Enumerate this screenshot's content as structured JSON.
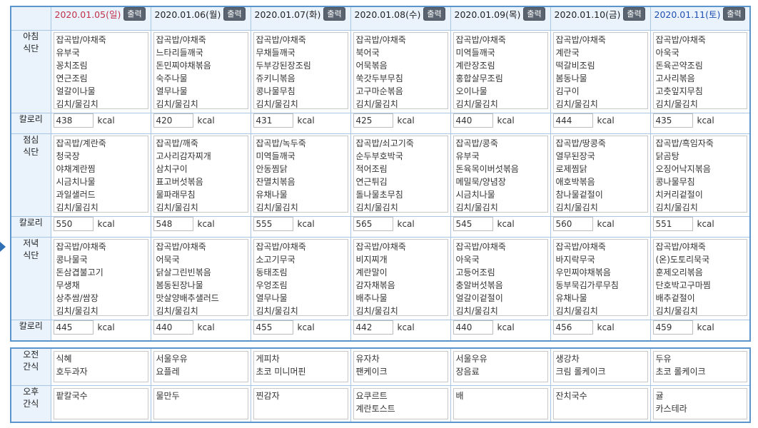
{
  "print_label": "출력",
  "kcal_unit": "kcal",
  "labels": {
    "breakfast": [
      "아침",
      "식단"
    ],
    "lunch": [
      "점심",
      "식단"
    ],
    "dinner": [
      "저녁",
      "식단"
    ],
    "calorie": "칼로리",
    "am_snack": [
      "오전",
      "간식"
    ],
    "pm_snack": [
      "오후",
      "간식"
    ]
  },
  "days": [
    {
      "date": "2020.01.05",
      "weekday": "(일)",
      "breakfast": [
        "잡곡밥/야채죽",
        "유부국",
        "꽁치조림",
        "연근조림",
        "얼갈이나물",
        "김치/물김치"
      ],
      "breakfast_kcal": "438",
      "lunch": [
        "잡곡밥/계란죽",
        "청국장",
        "야채계란찜",
        "시금치나물",
        "과일샐러드",
        "김치/물김치"
      ],
      "lunch_kcal": "550",
      "dinner": [
        "잡곡밥/야채죽",
        "콩나물국",
        "돈삼겹불고기",
        "무생채",
        "상추쌈/쌈장",
        "김치/물김치"
      ],
      "dinner_kcal": "445",
      "am_snack": [
        "식혜",
        "호두과자"
      ],
      "pm_snack": [
        "팥칼국수"
      ]
    },
    {
      "date": "2020.01.06",
      "weekday": "(월)",
      "breakfast": [
        "잡곡밥/야채죽",
        "느타리들깨국",
        "돈민찌야채볶음",
        "숙주나물",
        "열무나물",
        "김치/물김치"
      ],
      "breakfast_kcal": "420",
      "lunch": [
        "잡곡밥/깨죽",
        "고사리감자찌개",
        "삼치구이",
        "표고버섯볶음",
        "물파래무침",
        "김치/물김치"
      ],
      "lunch_kcal": "548",
      "dinner": [
        "잡곡밥/야채죽",
        "어묵국",
        "닭살그린빈볶음",
        "봄동된장나물",
        "맛살양배추샐러드",
        "김치/물김치"
      ],
      "dinner_kcal": "440",
      "am_snack": [
        "서울우유",
        "요플레"
      ],
      "pm_snack": [
        "물만두"
      ]
    },
    {
      "date": "2020.01.07",
      "weekday": "(화)",
      "breakfast": [
        "잡곡밥/야채죽",
        "무채들깨국",
        "두부강된장조림",
        "쥬키니볶음",
        "콩나물무침",
        "김치/물김치"
      ],
      "breakfast_kcal": "431",
      "lunch": [
        "잡곡밥/녹두죽",
        "미역들깨국",
        "안동찜닭",
        "잔멸치볶음",
        "유채나물",
        "김치/물김치"
      ],
      "lunch_kcal": "555",
      "dinner": [
        "잡곡밥/야채죽",
        "소고기무국",
        "동태조림",
        "우엉조림",
        "열무나물",
        "김치/물김치"
      ],
      "dinner_kcal": "455",
      "am_snack": [
        "게피차",
        "초코 미니머핀"
      ],
      "pm_snack": [
        "찐감자"
      ]
    },
    {
      "date": "2020.01.08",
      "weekday": "(수)",
      "breakfast": [
        "잡곡밥/야채죽",
        "북어국",
        "어묵볶음",
        "쑥갓두부무침",
        "고구마순볶음",
        "김치/물김치"
      ],
      "breakfast_kcal": "425",
      "lunch": [
        "잡곡밥/쇠고기죽",
        "순두부호박국",
        "적어조림",
        "연근튀김",
        "돌나물초무침",
        "김치/물김치"
      ],
      "lunch_kcal": "565",
      "dinner": [
        "잡곡밥/야채죽",
        "비지찌개",
        "계란말이",
        "감자채볶음",
        "배추나물",
        "김치/물김치"
      ],
      "dinner_kcal": "442",
      "am_snack": [
        "유자차",
        "팬케이크"
      ],
      "pm_snack": [
        "요쿠르트",
        "계란토스트"
      ]
    },
    {
      "date": "2020.01.09",
      "weekday": "(목)",
      "breakfast": [
        "잡곡밥/야채죽",
        "미역들깨국",
        "계란장조림",
        "홍합살무조림",
        "오이나물",
        "김치/물김치"
      ],
      "breakfast_kcal": "440",
      "lunch": [
        "잡곡밥/콩죽",
        "유부국",
        "돈육목이버섯볶음",
        "메밀묵/양념장",
        "시금치나물",
        "김치/물김치"
      ],
      "lunch_kcal": "545",
      "dinner": [
        "잡곡밥/야채죽",
        "아욱국",
        "고등어조림",
        "충알버섯볶음",
        "얼갈이겉절이",
        "김치/물김치"
      ],
      "dinner_kcal": "440",
      "am_snack": [
        "서울우유",
        "장음료"
      ],
      "pm_snack": [
        "배"
      ]
    },
    {
      "date": "2020.01.10",
      "weekday": "(금)",
      "breakfast": [
        "잡곡밥/야채죽",
        "계란국",
        "떡갈비조림",
        "봄동나물",
        "김구이",
        "김치/물김치"
      ],
      "breakfast_kcal": "444",
      "lunch": [
        "잡곡밥/땅콩죽",
        "열무된장국",
        "로제찜닭",
        "애호박볶음",
        "참나물겉절이",
        "김치/물김치"
      ],
      "lunch_kcal": "560",
      "dinner": [
        "잡곡밥/야채죽",
        "바지락무국",
        "우민찌야채볶음",
        "동부묵김가루무침",
        "유채나물",
        "김치/물김치"
      ],
      "dinner_kcal": "456",
      "am_snack": [
        "생강차",
        "크림 롤케이크"
      ],
      "pm_snack": [
        "잔치국수"
      ]
    },
    {
      "date": "2020.01.11",
      "weekday": "(토)",
      "breakfast": [
        "잡곡밥/야채죽",
        "아욱국",
        "돈육곤약조림",
        "고사리볶음",
        "고춧잎지무침",
        "김치/물김치"
      ],
      "breakfast_kcal": "435",
      "lunch": [
        "잡곡밥/흑임자죽",
        "닭곰탕",
        "오징어낙지볶음",
        "콩나물무침",
        "치커리겉절이",
        "김치/물김치"
      ],
      "lunch_kcal": "551",
      "dinner": [
        "잡곡밥/야채죽",
        "(온)도토리묵국",
        "훈제오리볶음",
        "단호박고구마찜",
        "배추겉절이",
        "김치/물김치"
      ],
      "dinner_kcal": "459",
      "am_snack": [
        "두유",
        "초코 롤케이크"
      ],
      "pm_snack": [
        "귤",
        "카스테라"
      ]
    }
  ]
}
